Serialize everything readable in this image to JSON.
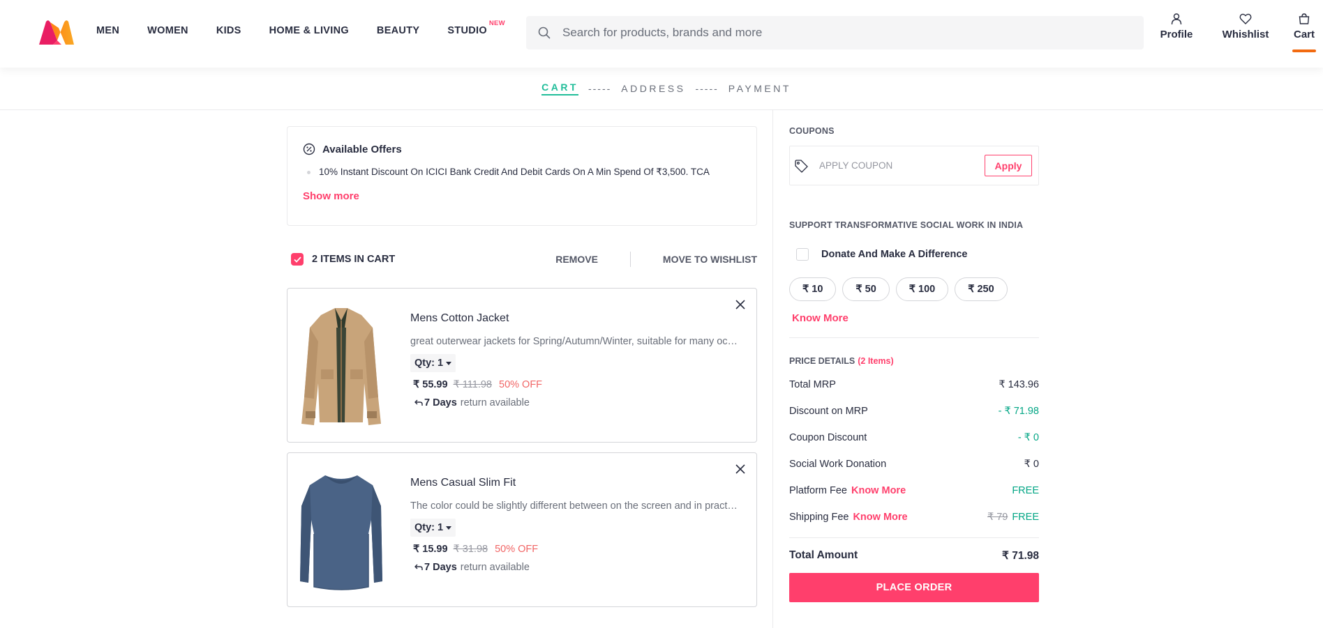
{
  "header": {
    "logo": "myntra-logo",
    "nav": [
      {
        "label": "MEN"
      },
      {
        "label": "WOMEN"
      },
      {
        "label": "KIDS"
      },
      {
        "label": "HOME & LIVING"
      },
      {
        "label": "BEAUTY"
      },
      {
        "label": "STUDIO",
        "badge": "NEW"
      }
    ],
    "search_placeholder": "Search for products, brands and more",
    "actions": {
      "profile": "Profile",
      "wishlist": "Whishlist",
      "cart": "Cart"
    },
    "accent": "#ff3f6c"
  },
  "steps": {
    "cart": "CART",
    "sep1": "-----",
    "address": "ADDRESS",
    "sep2": "-----",
    "payment": "PAYMENT",
    "active_color": "#20bd99"
  },
  "offers": {
    "title": "Available Offers",
    "line": "10% Instant Discount On ICICI Bank Credit And Debit Cards On A Min Spend Of ₹3,500. TCA",
    "show_more": "Show more"
  },
  "cart_bar": {
    "count_label": "2 ITEMS IN CART",
    "remove": "REMOVE",
    "move": "MOVE TO WISHLIST"
  },
  "items": [
    {
      "name": "Mens Cotton Jacket",
      "desc": "great outerwear jackets for Spring/Autumn/Winter, suitable for many occasions, such as working, hiking, camping",
      "qty": "Qty: 1",
      "price": "₹ 55.99",
      "mrp": "₹ 111.98",
      "off": "50% OFF",
      "return_days": "7 Days",
      "return_text": "return available"
    },
    {
      "name": "Mens Casual Slim Fit",
      "desc": "The color could be slightly different between on the screen and in practice. Please note that body builds vary",
      "qty": "Qty: 1",
      "price": "₹ 15.99",
      "mrp": "₹ 31.98",
      "off": "50% OFF",
      "return_days": "7 Days",
      "return_text": "return available"
    }
  ],
  "coupons": {
    "title": "COUPONS",
    "label": "APPLY COUPON",
    "apply": "Apply"
  },
  "social": {
    "title": "SUPPORT TRANSFORMATIVE SOCIAL WORK IN INDIA",
    "donate": "Donate And Make A Difference",
    "amounts": [
      "₹ 10",
      "₹ 50",
      "₹ 100",
      "₹ 250"
    ],
    "know_more": "Know More"
  },
  "price_details": {
    "title": "PRICE DETAILS",
    "count": "(2 Items)",
    "total_mrp_label": "Total MRP",
    "total_mrp": "₹ 143.96",
    "discount_label": "Discount on MRP",
    "discount": "- ₹ 71.98",
    "coupon_label": "Coupon Discount",
    "coupon": "- ₹ 0",
    "donation_label": "Social Work Donation",
    "donation": "₹ 0",
    "platform_label": "Platform Fee",
    "platform_km": "Know More",
    "platform": "FREE",
    "shipping_label": "Shipping Fee",
    "shipping_km": "Know More",
    "shipping_strike": "₹ 79",
    "shipping": "FREE",
    "total_label": "Total Amount",
    "total": "₹ 71.98",
    "place_order": "PLACE ORDER"
  }
}
